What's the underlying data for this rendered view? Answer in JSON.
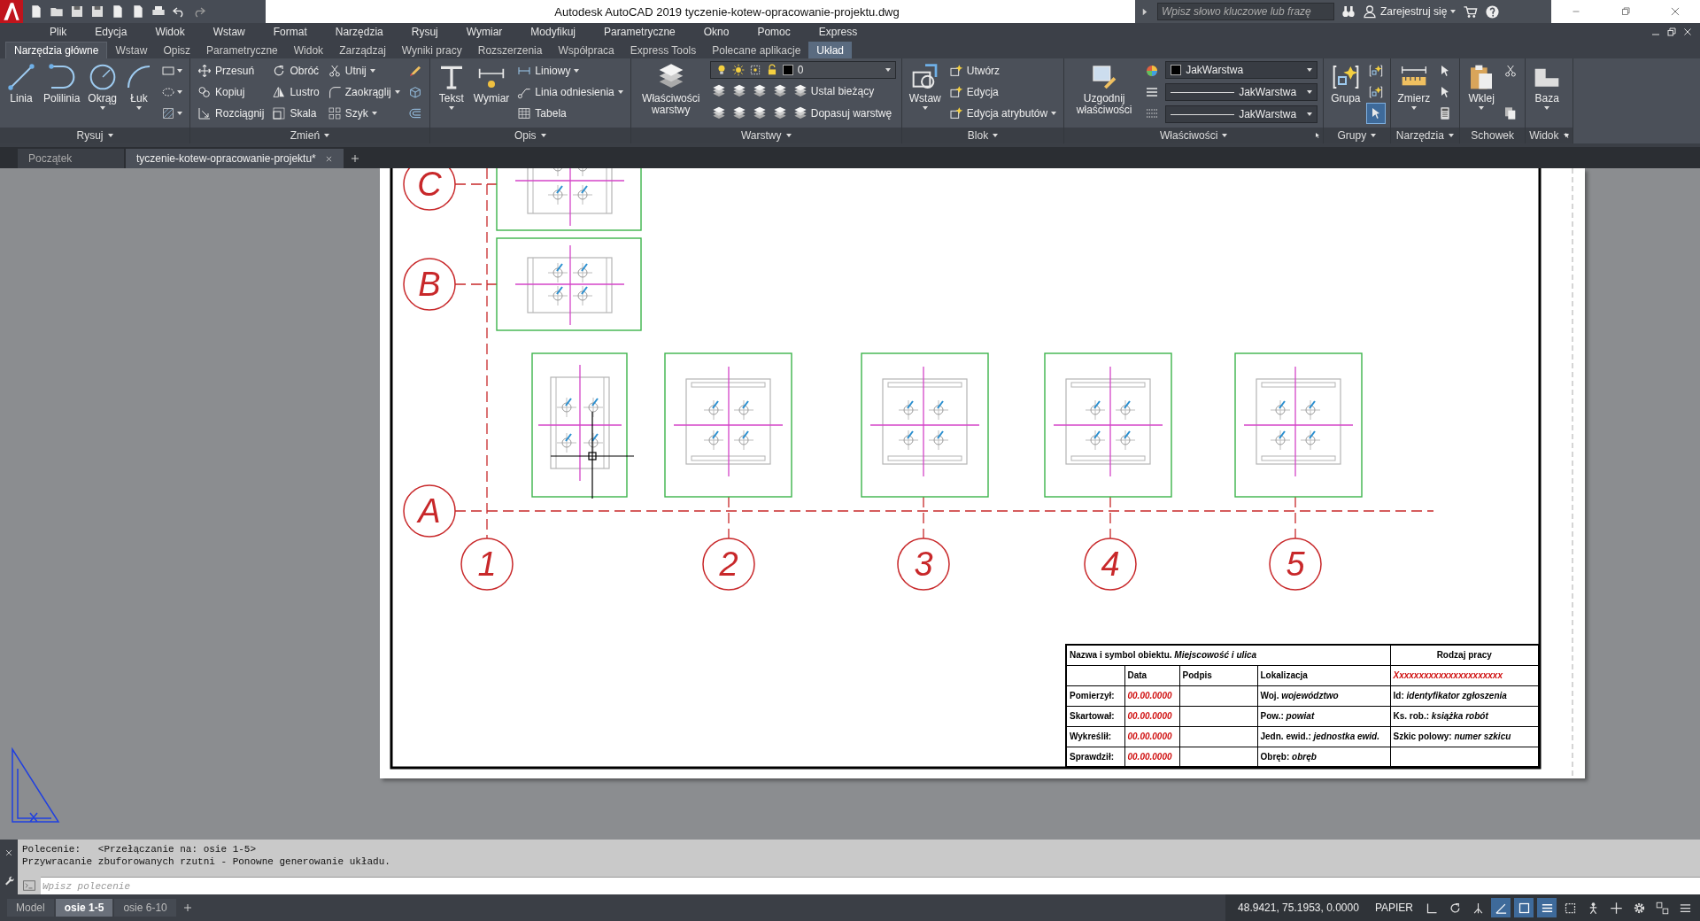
{
  "title_bar": {
    "title": "Autodesk AutoCAD 2019   tyczenie-kotew-opracowanie-projektu.dwg",
    "search": {
      "placeholder": "Wpisz słowo kluczowe lub frazę"
    },
    "account": "Zarejestruj się"
  },
  "menu": [
    "Plik",
    "Edycja",
    "Widok",
    "Wstaw",
    "Format",
    "Narzędzia",
    "Rysuj",
    "Wymiar",
    "Modyfikuj",
    "Parametryczne",
    "Okno",
    "Pomoc",
    "Express"
  ],
  "ribbon_tabs": [
    {
      "label": "Narzędzia główne",
      "selected": true,
      "contextual": false
    },
    {
      "label": "Wstaw",
      "selected": false,
      "contextual": false
    },
    {
      "label": "Opisz",
      "selected": false,
      "contextual": false
    },
    {
      "label": "Parametryczne",
      "selected": false,
      "contextual": false
    },
    {
      "label": "Widok",
      "selected": false,
      "contextual": false
    },
    {
      "label": "Zarządzaj",
      "selected": false,
      "contextual": false
    },
    {
      "label": "Wyniki pracy",
      "selected": false,
      "contextual": false
    },
    {
      "label": "Rozszerzenia",
      "selected": false,
      "contextual": false
    },
    {
      "label": "Współpraca",
      "selected": false,
      "contextual": false
    },
    {
      "label": "Express Tools",
      "selected": false,
      "contextual": false
    },
    {
      "label": "Polecane aplikacje",
      "selected": false,
      "contextual": false
    },
    {
      "label": "Układ",
      "selected": false,
      "contextual": true
    }
  ],
  "ribbon_panels": [
    {
      "title": "Rysuj",
      "expandable": true,
      "launcher": false,
      "columns": [
        [
          {
            "kind": "large",
            "label": "Linia",
            "dropdown": false
          }
        ],
        [
          {
            "kind": "large",
            "label": "Polilinia",
            "dropdown": false
          }
        ],
        [
          {
            "kind": "large",
            "label": "Okrąg",
            "dropdown": true
          }
        ],
        [
          {
            "kind": "large",
            "label": "Łuk",
            "dropdown": true
          }
        ],
        [
          {
            "kind": "icon",
            "dropdown": true
          },
          {
            "kind": "icon",
            "dropdown": true
          },
          {
            "kind": "icon",
            "dropdown": true
          }
        ]
      ]
    },
    {
      "title": "Zmień",
      "expandable": true,
      "launcher": false,
      "columns": [
        [
          {
            "kind": "small",
            "label": "Przesuń",
            "dropdown": false
          },
          {
            "kind": "small",
            "label": "Kopiuj",
            "dropdown": false
          },
          {
            "kind": "small",
            "label": "Rozciągnij",
            "dropdown": false
          }
        ],
        [
          {
            "kind": "small",
            "label": "Obróć",
            "dropdown": false
          },
          {
            "kind": "small",
            "label": "Lustro",
            "dropdown": false
          },
          {
            "kind": "small",
            "label": "Skala",
            "dropdown": false
          }
        ],
        [
          {
            "kind": "small",
            "label": "Utnij",
            "dropdown": true
          },
          {
            "kind": "small",
            "label": "Zaokrąglij",
            "dropdown": true
          },
          {
            "kind": "small",
            "label": "Szyk",
            "dropdown": true
          }
        ],
        [
          {
            "kind": "icon",
            "dropdown": false
          },
          {
            "kind": "icon",
            "dropdown": false
          },
          {
            "kind": "icon",
            "dropdown": false
          }
        ]
      ]
    },
    {
      "title": "Opis",
      "expandable": true,
      "launcher": false,
      "columns": [
        [
          {
            "kind": "large",
            "label": "Tekst",
            "dropdown": true
          }
        ],
        [
          {
            "kind": "large",
            "label": "Wymiar",
            "dropdown": false
          }
        ],
        [
          {
            "kind": "small",
            "label": "Liniowy",
            "dropdown": true
          },
          {
            "kind": "small",
            "label": "Linia odniesienia",
            "dropdown": true
          },
          {
            "kind": "small",
            "label": "Tabela",
            "dropdown": false
          }
        ]
      ]
    },
    {
      "title": "Warstwy",
      "expandable": true,
      "launcher": false,
      "columns": [
        [
          {
            "kind": "large",
            "label": "Właściwości warstwy",
            "dropdown": false
          }
        ],
        [
          {
            "kind": "row",
            "items": [
              {
                "kind": "layer-select",
                "value": "0"
              }
            ]
          },
          {
            "kind": "row",
            "items": [
              {
                "kind": "icon",
                "dropdown": false
              },
              {
                "kind": "icon",
                "dropdown": false
              },
              {
                "kind": "icon",
                "dropdown": false
              },
              {
                "kind": "icon",
                "dropdown": false
              },
              {
                "kind": "small",
                "label": "Ustal bieżący",
                "dropdown": false
              }
            ]
          },
          {
            "kind": "row",
            "items": [
              {
                "kind": "icon",
                "dropdown": false
              },
              {
                "kind": "icon",
                "dropdown": false
              },
              {
                "kind": "icon",
                "dropdown": false
              },
              {
                "kind": "icon",
                "dropdown": false
              },
              {
                "kind": "small",
                "label": "Dopasuj warstwę",
                "dropdown": false
              }
            ]
          }
        ]
      ]
    },
    {
      "title": "Blok",
      "expandable": true,
      "launcher": false,
      "columns": [
        [
          {
            "kind": "large",
            "label": "Wstaw",
            "dropdown": true
          }
        ],
        [
          {
            "kind": "small",
            "label": "Utwórz",
            "dropdown": false
          },
          {
            "kind": "small",
            "label": "Edycja",
            "dropdown": false
          },
          {
            "kind": "small",
            "label": "Edycja atrybutów",
            "dropdown": true
          }
        ]
      ]
    },
    {
      "title": "Właściwości",
      "expandable": true,
      "launcher": true,
      "columns": [
        [
          {
            "kind": "large",
            "label": "Uzgodnij właściwości",
            "dropdown": false
          }
        ],
        [
          {
            "kind": "icon",
            "dropdown": false
          },
          {
            "kind": "icon",
            "dropdown": false
          },
          {
            "kind": "icon",
            "dropdown": false
          }
        ],
        [
          {
            "kind": "color-select",
            "value": "JakWarstwa"
          },
          {
            "kind": "line-select",
            "value": "JakWarstwa"
          },
          {
            "kind": "line-select",
            "value": "JakWarstwa"
          }
        ]
      ]
    },
    {
      "title": "Grupy",
      "expandable": true,
      "launcher": false,
      "columns": [
        [
          {
            "kind": "large",
            "label": "Grupa",
            "dropdown": false
          }
        ],
        [
          {
            "kind": "icon",
            "dropdown": false,
            "on": false
          },
          {
            "kind": "icon",
            "dropdown": false,
            "on": false
          },
          {
            "kind": "icon",
            "dropdown": false,
            "on": true
          }
        ]
      ]
    },
    {
      "title": "Narzędzia",
      "expandable": true,
      "launcher": false,
      "columns": [
        [
          {
            "kind": "large",
            "label": "Zmierz",
            "dropdown": true
          }
        ],
        [
          {
            "kind": "icon",
            "dropdown": false
          },
          {
            "kind": "icon",
            "dropdown": false
          },
          {
            "kind": "icon",
            "dropdown": false
          }
        ]
      ]
    },
    {
      "title": "Schowek",
      "expandable": false,
      "launcher": false,
      "columns": [
        [
          {
            "kind": "large",
            "label": "Wklej",
            "dropdown": true
          }
        ],
        [
          {
            "kind": "icon",
            "dropdown": false
          },
          {
            "kind": "icon",
            "dropdown": false
          }
        ]
      ]
    },
    {
      "title": "Widok",
      "expandable": true,
      "launcher": true,
      "columns": [
        [
          {
            "kind": "large",
            "label": "Baza",
            "dropdown": true
          }
        ]
      ]
    }
  ],
  "document_tabs": [
    {
      "label": "Początek",
      "selected": false
    },
    {
      "label": "tyczenie-kotew-opracowanie-projektu*",
      "selected": true
    }
  ],
  "drawing": {
    "row_axes": [
      "C",
      "B",
      "A"
    ],
    "column_axes": [
      "1",
      "2",
      "3",
      "4",
      "5"
    ],
    "title_block": [
      {
        "kind": "header",
        "cells": [
          {
            "text": "Nazwa i symbol obiektu. *Miejscowość i ulica*",
            "kind": "label"
          },
          {
            "text": "Rodzaj pracy",
            "kind": "label"
          }
        ]
      },
      {
        "kind": "body",
        "cells": [
          null,
          {
            "text": "Data",
            "kind": "label"
          },
          {
            "text": "Podpis",
            "kind": "label"
          },
          {
            "text": "Lokalizacja",
            "kind": "label"
          },
          {
            "text": "Xxxxxxxxxxxxxxxxxxxxxx",
            "kind": "value"
          }
        ]
      },
      {
        "kind": "body",
        "cells": [
          {
            "text": "Pomierzył:",
            "kind": "label"
          },
          {
            "text": "00.00.0000",
            "kind": "value"
          },
          null,
          {
            "text": "Woj. *województwo*",
            "kind": "label"
          },
          {
            "text": "Id: *identyfikator zgłoszenia*",
            "kind": "label"
          }
        ]
      },
      {
        "kind": "body",
        "cells": [
          {
            "text": "Skartował:",
            "kind": "label"
          },
          {
            "text": "00.00.0000",
            "kind": "value"
          },
          null,
          {
            "text": "Pow.: *powiat*",
            "kind": "label"
          },
          {
            "text": "Ks. rob.: *książka robót*",
            "kind": "label"
          }
        ]
      },
      {
        "kind": "body",
        "cells": [
          {
            "text": "Wykreślił:",
            "kind": "label"
          },
          {
            "text": "00.00.0000",
            "kind": "value"
          },
          null,
          {
            "text": "Jedn. ewid.: *jednostka ewid.*",
            "kind": "label"
          },
          {
            "text": "Szkic polowy: *numer szkicu*",
            "kind": "label"
          }
        ]
      },
      {
        "kind": "body",
        "cells": [
          {
            "text": "Sprawdził:",
            "kind": "label"
          },
          {
            "text": "00.00.0000",
            "kind": "value"
          },
          null,
          {
            "text": "Obręb: *obręb*",
            "kind": "label"
          },
          null
        ]
      }
    ]
  },
  "command_line": {
    "history": [
      "Polecenie:   <Przełączanie na: osie 1-5>",
      "Przywracanie zbuforowanych rzutni - Ponowne generowanie układu."
    ],
    "input": {
      "placeholder": "Wpisz polecenie"
    }
  },
  "status_bar": {
    "layout_tabs": [
      {
        "label": "Model",
        "selected": false
      },
      {
        "label": "osie 1-5",
        "selected": true
      },
      {
        "label": "osie 6-10",
        "selected": false
      }
    ],
    "coordinates": "48.9421, 75.1953, 0.0000",
    "space": "PAPIER",
    "toggles": [
      {
        "on": false
      },
      {
        "on": false
      },
      {
        "on": false
      },
      {
        "on": true
      },
      {
        "on": true
      },
      {
        "on": true
      },
      {
        "on": false
      },
      {
        "on": false
      },
      {
        "on": false
      },
      {
        "on": false
      },
      {
        "on": false
      },
      {
        "on": false
      }
    ]
  }
}
